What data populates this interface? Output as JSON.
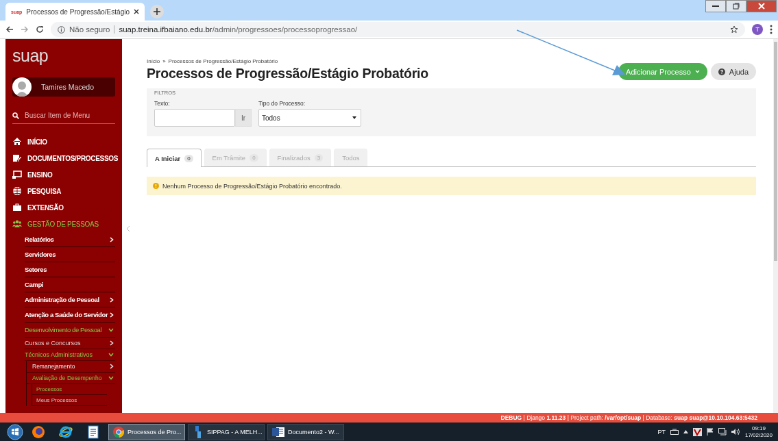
{
  "browser": {
    "tab_title": "Processos de Progressão/Estágio",
    "favicon": "suap",
    "security": "Não seguro",
    "url_host": "suap.treina.ifbaiano.edu.br",
    "url_path": "/admin/progressoes/processoprogressao/",
    "profile": "T"
  },
  "sidebar": {
    "logo": "suap",
    "user": "Tamires Macedo",
    "search_placeholder": "Buscar Item de Menu",
    "menu": [
      {
        "label": "INÍCIO",
        "selected": false
      },
      {
        "label": "DOCUMENTOS/PROCESSOS",
        "selected": false
      },
      {
        "label": "ENSINO",
        "selected": false
      },
      {
        "label": "PESQUISA",
        "selected": false
      },
      {
        "label": "EXTENSÃO",
        "selected": false
      },
      {
        "label": "GESTÃO DE PESSOAS",
        "selected": true,
        "children": [
          {
            "label": "Relatórios",
            "selected": false,
            "expanded": false
          },
          {
            "label": "Servidores",
            "selected": false
          },
          {
            "label": "Setores",
            "selected": false
          },
          {
            "label": "Campi",
            "selected": false
          },
          {
            "label": "Administração de Pessoal",
            "selected": false,
            "expanded": false
          },
          {
            "label": "Atenção a Saúde do Servidor",
            "selected": false,
            "expanded": false
          },
          {
            "label": "Desenvolvimento de Pessoal",
            "selected": true,
            "expanded": true,
            "children": [
              {
                "label": "Cursos e Concursos",
                "selected": false,
                "expanded": false
              },
              {
                "label": "Técnicos Administrativos",
                "selected": true,
                "expanded": true,
                "children": [
                  {
                    "label": "Remanejamento",
                    "selected": false,
                    "expanded": false
                  },
                  {
                    "label": "Avaliação de Desempenho",
                    "selected": true,
                    "expanded": true,
                    "children": [
                      {
                        "label": "Processos",
                        "selected": true
                      },
                      {
                        "label": "Meus Processos",
                        "selected": false
                      }
                    ]
                  }
                ]
              }
            ]
          }
        ]
      }
    ]
  },
  "main": {
    "breadcrumb": [
      "Início",
      "Processos de Progressão/Estágio Probatório"
    ],
    "breadcrumb_separator": "»",
    "title": "Processos de Progressão/Estágio Probatório",
    "actions": [
      {
        "label": "Adicionar Processo",
        "kind": "primary"
      },
      {
        "label": "Ajuda",
        "kind": "help"
      }
    ],
    "filters": {
      "legend": "FILTROS",
      "text_label": "Texto:",
      "go_button": "Ir",
      "type_label": "Tipo do Processo:",
      "type_value": "Todos"
    },
    "tabs": [
      {
        "label": "A Iniciar",
        "count": "0",
        "selected": true
      },
      {
        "label": "Em Trâmite",
        "count": "0",
        "selected": false
      },
      {
        "label": "Finalizados",
        "count": "3",
        "selected": false
      },
      {
        "label": "Todos",
        "selected": false
      }
    ],
    "alert": "Nenhum Processo de Progressão/Estágio Probatório encontrado."
  },
  "debug_bar": "**DEBUG** | Django **1.11.23** | Project path: **/var/opt/suap** | Database: **suap suap@10.10.104.63:5432**",
  "taskbar": {
    "apps": [
      {
        "label": "Processos de Pro...",
        "kind": "chrome",
        "selected": true
      },
      {
        "label": "SIPPAG - A MELH...",
        "kind": "sippag",
        "selected": false
      },
      {
        "label": "Documento2 - W...",
        "kind": "word",
        "selected": false
      }
    ],
    "language": "PT",
    "time": "09:19",
    "date": "17/02/2020"
  }
}
